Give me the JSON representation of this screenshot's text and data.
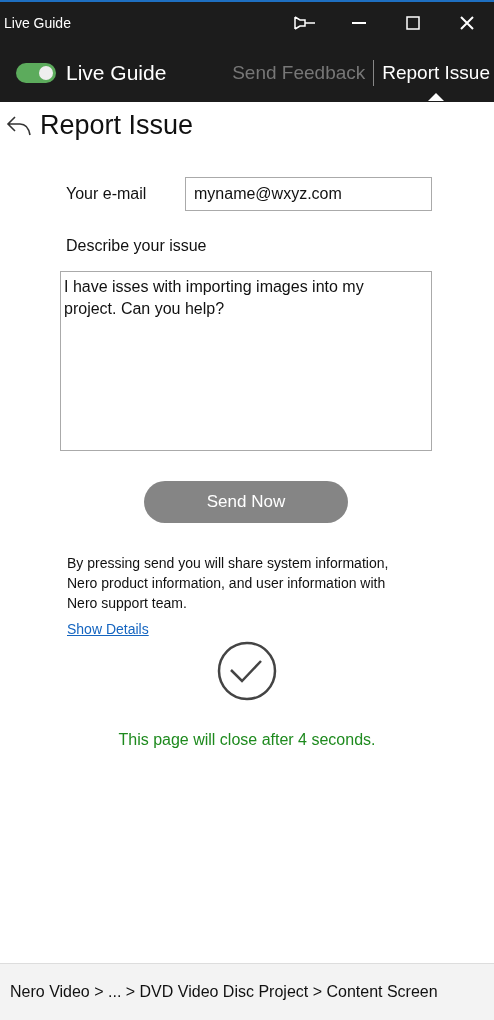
{
  "window": {
    "title": "Live Guide"
  },
  "toggle": {
    "label": "Live Guide",
    "on": true
  },
  "tabs": [
    {
      "label": "Send Feedback",
      "selected": false
    },
    {
      "label": "Report Issue",
      "selected": true
    }
  ],
  "page": {
    "title": "Report Issue"
  },
  "form": {
    "email_label": "Your e-mail",
    "email_value": "myname@wxyz.com",
    "issue_label": "Describe your issue",
    "issue_value": "I have isses with importing images into my project. Can you help?"
  },
  "send_button": {
    "label": "Send Now",
    "disabled": true
  },
  "notice": "By pressing send you will share system information, Nero product information, and user information with Nero support team.",
  "details_link": "Show Details",
  "success": {
    "message": "This page will close after 4 seconds."
  },
  "status_bar": {
    "path": "Nero Video > ... > DVD Video Disc Project > Content Screen"
  }
}
